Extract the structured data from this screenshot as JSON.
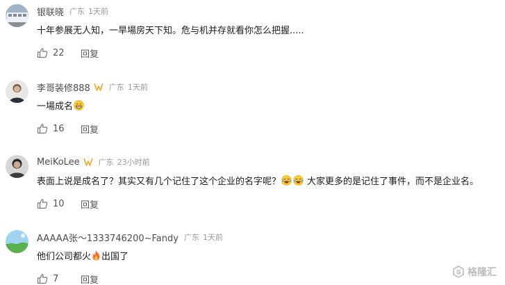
{
  "comments": [
    {
      "user": "银联晓",
      "vip": false,
      "location": "广东",
      "time": "1天前",
      "text": "十年参展无人知，一旱場房天下知。危与机并存就看你怎么把握.....",
      "likes": "22",
      "reply": "回复"
    },
    {
      "user": "李哥装修888",
      "vip": true,
      "location": "广东",
      "time": "1天前",
      "text": "一場成名",
      "likes": "16",
      "reply": "回复"
    },
    {
      "user": "MeiKoLee",
      "vip": true,
      "location": "广东",
      "time": "23小时前",
      "text_a": "表面上说是成名了？其实又有几个记住了这个企业的名字呢？",
      "text_b": "大家更多的是记住了事件，而不是企业名。",
      "likes": "10",
      "reply": "回复"
    },
    {
      "user": "AAAAA张～1333746200~Fandy",
      "vip": false,
      "location": "广东",
      "time": "1天前",
      "text_a": "他们公司都火",
      "text_b": "出国了",
      "likes": "7",
      "reply": "回复"
    }
  ],
  "watermark": {
    "text": "格隆汇"
  },
  "colors": {
    "vip": "#f5a623",
    "meta": "#999999",
    "fire": "#ff6a2b"
  }
}
